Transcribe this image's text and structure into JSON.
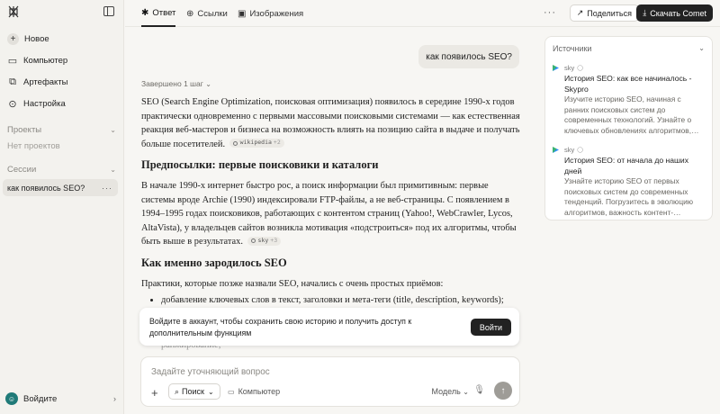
{
  "sidebar": {
    "new_label": "Новое",
    "items": [
      {
        "label": "Компьютер",
        "icon": "computer-icon"
      },
      {
        "label": "Артефакты",
        "icon": "artifact-icon"
      },
      {
        "label": "Настройка",
        "icon": "settings-icon"
      }
    ],
    "projects_label": "Проекты",
    "projects_empty": "Нет проектов",
    "sessions_label": "Сессии",
    "active_session": "как появилось SEO?",
    "login_label": "Войдите"
  },
  "topbar": {
    "tabs": [
      {
        "label": "Ответ",
        "icon": "answer-icon",
        "active": true
      },
      {
        "label": "Ссылки",
        "icon": "globe-icon",
        "active": false
      },
      {
        "label": "Изображения",
        "icon": "image-icon",
        "active": false
      }
    ],
    "share_label": "Поделиться",
    "download_label": "Скачать Comet"
  },
  "main": {
    "question": "как появилось SEO?",
    "status": "Завершено 1 шаг",
    "intro": "SEO (Search Engine Optimization, поисковая оптимизация) появилось в середине 1990-х годов практически одновременно с первыми массовыми поисковыми системами — как естественная реакция веб-мастеров и бизнеса на возможность влиять на позицию сайта в выдаче и получать больше посетителей.",
    "intro_cite": "wikipedia",
    "intro_cite_more": "+2",
    "h1": "Предпосылки: первые поисковики и каталоги",
    "p1": "В начале 1990-х интернет быстро рос, а поиск информации был примитивным: первые системы вроде Archie (1990) индексировали FTP-файлы, а не веб-страницы. С появлением в 1994–1995 годах поисковиков, работающих с контентом страниц (Yahoo!, WebCrawler, Lycos, AltaVista), у владельцев сайтов возникла мотивация «подстроиться» под их алгоритмы, чтобы быть выше в результатах.",
    "p1_cite": "sky",
    "p1_cite_more": "+3",
    "h2": "Как именно зародилось SEO",
    "p2": "Практики, которые позже назвали SEO, начались с очень простых приёмов:",
    "bullet1": "добавление ключевых слов в текст, заголовки и мета-теги (title, description, keywords);",
    "faded": "ранжирование;"
  },
  "login_banner": {
    "text": "Войдите в аккаунт, чтобы сохранить свою историю и получить доступ к дополнительным функциям",
    "button": "Войти"
  },
  "composer": {
    "placeholder": "Задайте уточняющий вопрос",
    "search_label": "Поиск",
    "computer_label": "Компьютер",
    "model_label": "Модель"
  },
  "sources": {
    "title": "Источники",
    "items": [
      {
        "site": "sky",
        "title": "История SEO: как все начиналось - Skypro",
        "desc": "Изучите историю SEO, начиная с ранних поисковых систем до современных технологий. Узнайте о ключевых обновлениях алгоритмов,…"
      },
      {
        "site": "sky",
        "title": "История SEO: от начала до наших дней",
        "desc": "Узнайте историю SEO от первых поисковых систем до современных тенденций. Погрузитесь в эволюцию алгоритмов, важность контент-…"
      }
    ]
  }
}
